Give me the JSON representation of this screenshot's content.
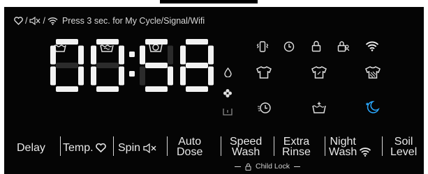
{
  "hint": {
    "text": "Press 3 sec. for My Cycle/Signal/Wifi"
  },
  "display": {
    "time": "00:58"
  },
  "buttons": {
    "delay": "Delay",
    "temp": "Temp.",
    "spin": "Spin",
    "auto_dose_line1": "Auto",
    "auto_dose_line2": "Dose",
    "speed_wash_line1": "Speed",
    "speed_wash_line2": "Wash",
    "extra_rinse_line1": "Extra",
    "extra_rinse_line2": "Rinse",
    "night_wash_line1": "Night",
    "night_wash_line2": "Wash",
    "soil_level_line1": "Soil",
    "soil_level_line2": "Level"
  },
  "child_lock": {
    "label": "Child Lock"
  },
  "colors": {
    "panel": "#050505",
    "text": "#e6e6e6",
    "accent_moon": "#2aa8ff",
    "digit_off": "#2b2b2b"
  }
}
